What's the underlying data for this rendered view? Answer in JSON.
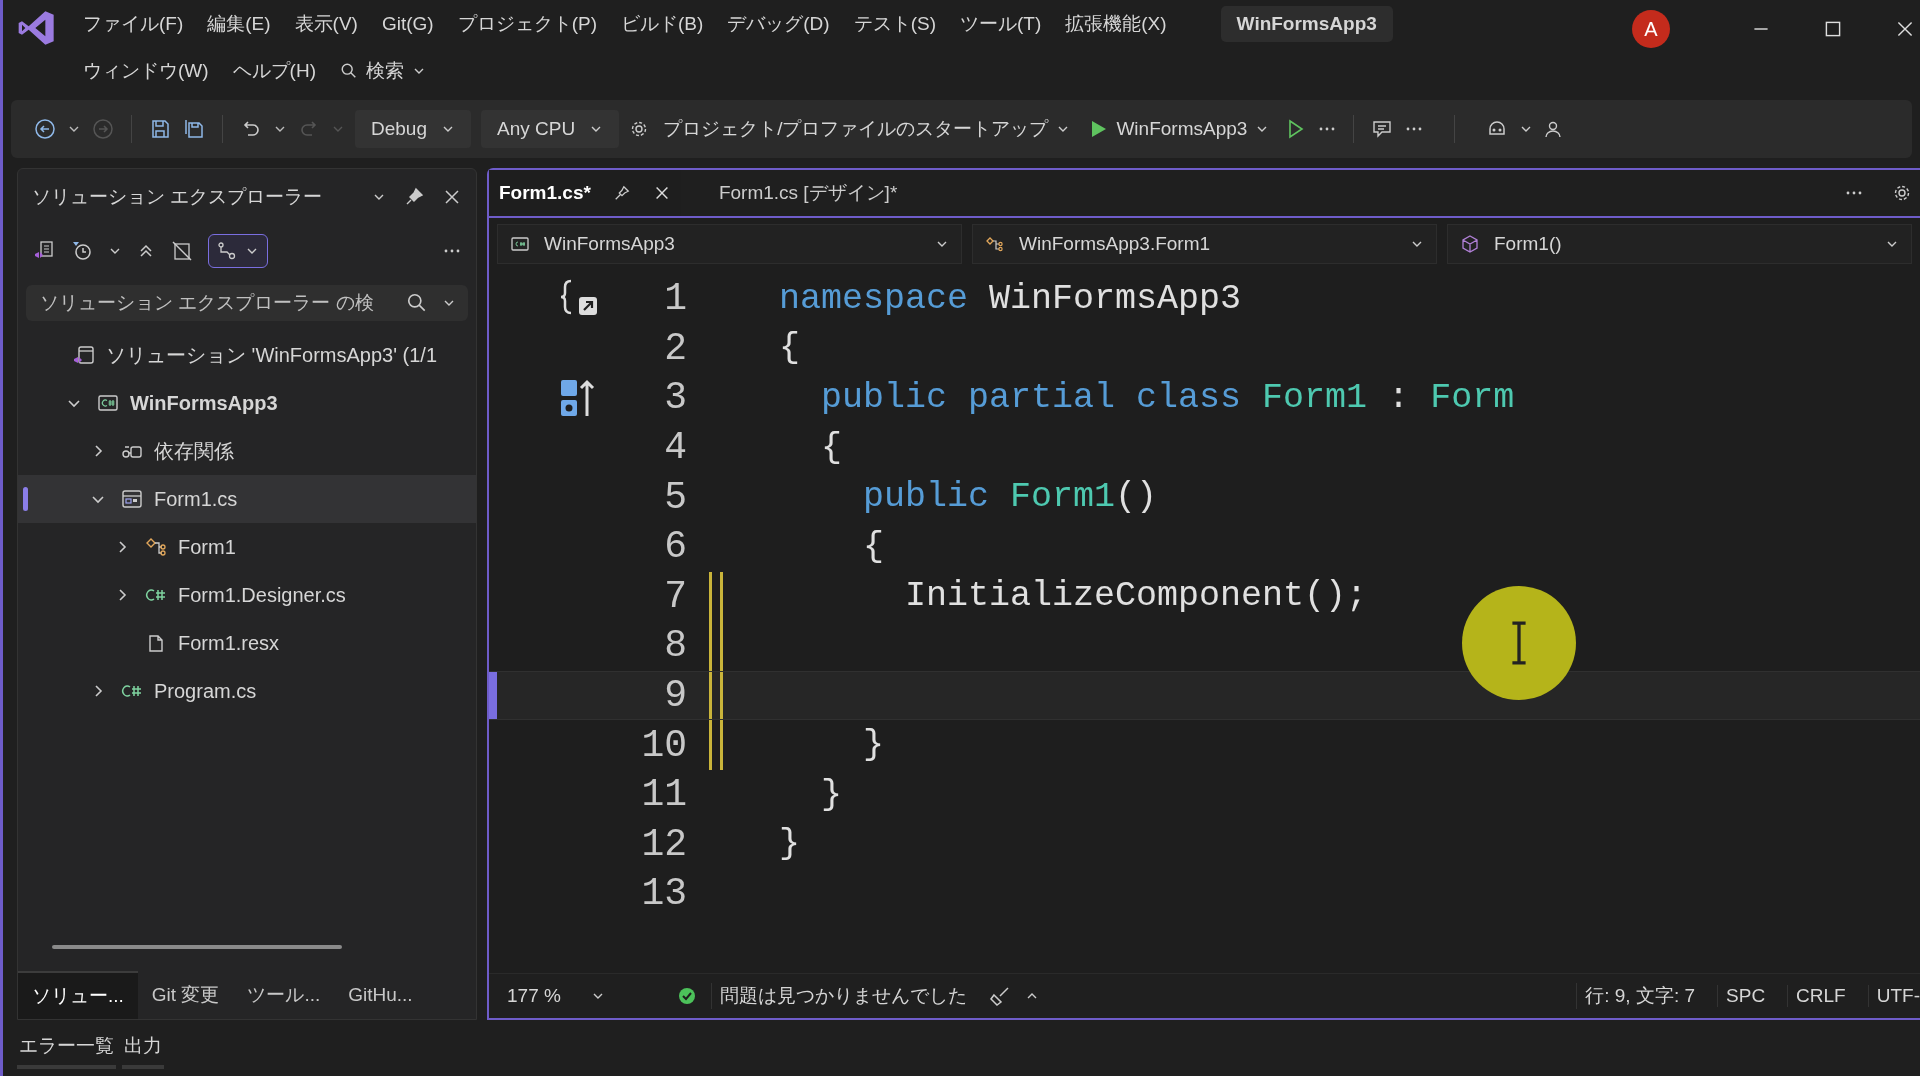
{
  "window": {
    "title": "WinFormsApp3",
    "avatar": "A"
  },
  "menu": {
    "row_1": [
      "ファイル(F)",
      "編集(E)",
      "表示(V)",
      "Git(G)",
      "プロジェクト(P)",
      "ビルド(B)",
      "デバッグ(D)",
      "テスト(S)",
      "ツール(T)",
      "拡張機能(X)"
    ],
    "row_2": [
      "ウィンドウ(W)",
      "ヘルプ(H)"
    ],
    "search": "検索"
  },
  "toolbar": {
    "configuration": "Debug",
    "platform": "Any CPU",
    "startup": "プロジェクト/プロファイルのスタートアップ",
    "run_target": "WinFormsApp3"
  },
  "solution_explorer": {
    "title": "ソリューション エクスプローラー",
    "sync_view_on": true,
    "search": {
      "placeholder": "ソリューション エクスプローラー の検"
    },
    "tree": [
      {
        "label": "ソリューション 'WinFormsApp3' (1/1",
        "kind": "solution",
        "selected": false,
        "children": [
          {
            "label": "WinFormsApp3",
            "kind": "project",
            "expanded": true,
            "selected": false,
            "children": [
              {
                "label": "依存関係",
                "kind": "dependencies",
                "expanded": false,
                "selected": false
              },
              {
                "label": "Form1.cs",
                "kind": "form",
                "expanded": true,
                "selected": true,
                "children": [
                  {
                    "label": "Form1",
                    "kind": "class",
                    "expanded": false,
                    "selected": false
                  },
                  {
                    "label": "Form1.Designer.cs",
                    "kind": "csharp",
                    "expanded": false,
                    "selected": false
                  },
                  {
                    "label": "Form1.resx",
                    "kind": "resource",
                    "selected": false
                  }
                ]
              },
              {
                "label": "Program.cs",
                "kind": "csharp",
                "expanded": false,
                "selected": false
              }
            ]
          }
        ]
      }
    ],
    "tabs": [
      {
        "label": "ソリュー...",
        "selected": true
      },
      {
        "label": "Git 変更",
        "selected": false
      },
      {
        "label": "ツール...",
        "selected": false
      },
      {
        "label": "GitHu...",
        "selected": false
      }
    ]
  },
  "editor": {
    "tabs": [
      {
        "label": "Form1.cs*",
        "selected": true
      },
      {
        "label": "Form1.cs [デザイン]*",
        "selected": false
      }
    ],
    "navigation": [
      "WinFormsApp3",
      "WinFormsApp3.Form1",
      "Form1()"
    ],
    "lines": [
      {
        "number": "1",
        "modified": false,
        "current": false,
        "tokens": [
          {
            "text": "namespace",
            "kind": "keyword"
          },
          {
            "text": " WinFormsApp3",
            "kind": "plain"
          }
        ]
      },
      {
        "number": "2",
        "modified": false,
        "current": false,
        "tokens": [
          {
            "text": "{",
            "kind": "plain"
          }
        ]
      },
      {
        "number": "3",
        "modified": false,
        "current": false,
        "tokens": [
          {
            "text": "  public partial class",
            "kind": "keyword"
          },
          {
            "text": " Form1",
            "kind": "type"
          },
          {
            "text": " : ",
            "kind": "plain"
          },
          {
            "text": "Form",
            "kind": "type"
          }
        ]
      },
      {
        "number": "4",
        "modified": false,
        "current": false,
        "tokens": [
          {
            "text": "  {",
            "kind": "plain"
          }
        ]
      },
      {
        "number": "5",
        "modified": false,
        "current": false,
        "tokens": [
          {
            "text": "    public",
            "kind": "keyword"
          },
          {
            "text": " Form1",
            "kind": "type"
          },
          {
            "text": "()",
            "kind": "plain"
          }
        ]
      },
      {
        "number": "6",
        "modified": false,
        "current": false,
        "tokens": [
          {
            "text": "    {",
            "kind": "plain"
          }
        ]
      },
      {
        "number": "7",
        "modified": true,
        "current": false,
        "tokens": [
          {
            "text": "      InitializeComponent();",
            "kind": "plain"
          }
        ]
      },
      {
        "number": "8",
        "modified": true,
        "current": false
      },
      {
        "number": "9",
        "modified": true,
        "current": true
      },
      {
        "number": "10",
        "modified": true,
        "current": false,
        "tokens": [
          {
            "text": "    }",
            "kind": "plain"
          }
        ]
      },
      {
        "number": "11",
        "modified": false,
        "current": false,
        "tokens": [
          {
            "text": "  }",
            "kind": "plain"
          }
        ]
      },
      {
        "number": "12",
        "modified": false,
        "current": false,
        "tokens": [
          {
            "text": "}",
            "kind": "plain"
          }
        ]
      },
      {
        "number": "13",
        "modified": false,
        "current": false
      }
    ]
  },
  "status_bar": {
    "zoom": "177 %",
    "issues": "問題は見つかりませんでした",
    "position": "行: 9, 文字: 7",
    "whitespace": "SPC",
    "line_ending": "CRLF",
    "encoding": "UTF-"
  },
  "bottom_tabs": [
    {
      "label": "エラー一覧",
      "selected": false
    },
    {
      "label": "出力",
      "selected": false
    }
  ]
}
